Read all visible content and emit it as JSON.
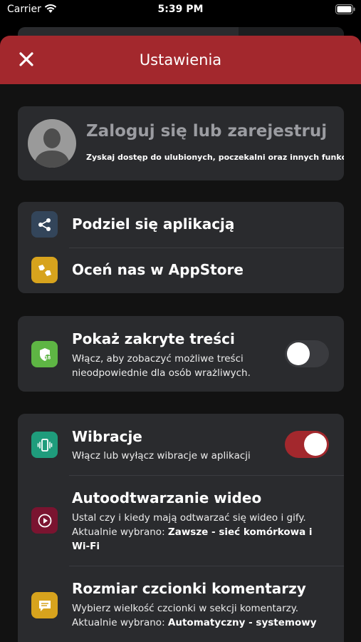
{
  "status_bar": {
    "carrier": "Carrier",
    "time": "5:39 PM"
  },
  "header": {
    "title": "Ustawienia",
    "close_icon": "close-icon",
    "color": "#a3282d"
  },
  "login": {
    "title": "Zaloguj się lub zarejestruj",
    "subtitle": "Zyskaj dostęp do ulubionych, poczekalni oraz innych funkcji",
    "avatar_icon": "avatar-icon"
  },
  "share_section": {
    "share": {
      "label": "Podziel się aplikacją",
      "icon": "share-icon",
      "icon_color": "#33455a"
    },
    "rate": {
      "label": "Oceń nas w AppStore",
      "icon": "thumbs-icon",
      "icon_color": "#d7a31d"
    }
  },
  "hidden_content": {
    "title": "Pokaż zakryte treści",
    "description": "Włącz, aby zobaczyć możliwe treści nieodpowiednie dla osób wrażliwych.",
    "icon": "shield-icon",
    "icon_color": "#5eb544",
    "enabled": false
  },
  "preferences": {
    "vibrations": {
      "title": "Wibracje",
      "description": "Włącz lub wyłącz wibracje w aplikacji",
      "icon": "vibration-icon",
      "icon_color": "#1f9c7c",
      "enabled": true
    },
    "autoplay": {
      "title": "Autoodtwarzanie wideo",
      "description": "Ustal czy i kiedy mają odtwarzać się wideo i gify.",
      "current_prefix": "Aktualnie wybrano:",
      "current_value": "Zawsze - sieć komórkowa i Wi-Fi",
      "icon": "play-icon",
      "icon_color": "#7a1430"
    },
    "font_size": {
      "title": "Rozmiar czcionki komentarzy",
      "description": "Wybierz wielkość czcionki w sekcji komentarzy.",
      "current_prefix": "Aktualnie wybrano:",
      "current_value": "Automatyczny - systemowy",
      "icon": "comment-icon",
      "icon_color": "#d7a31d"
    }
  }
}
